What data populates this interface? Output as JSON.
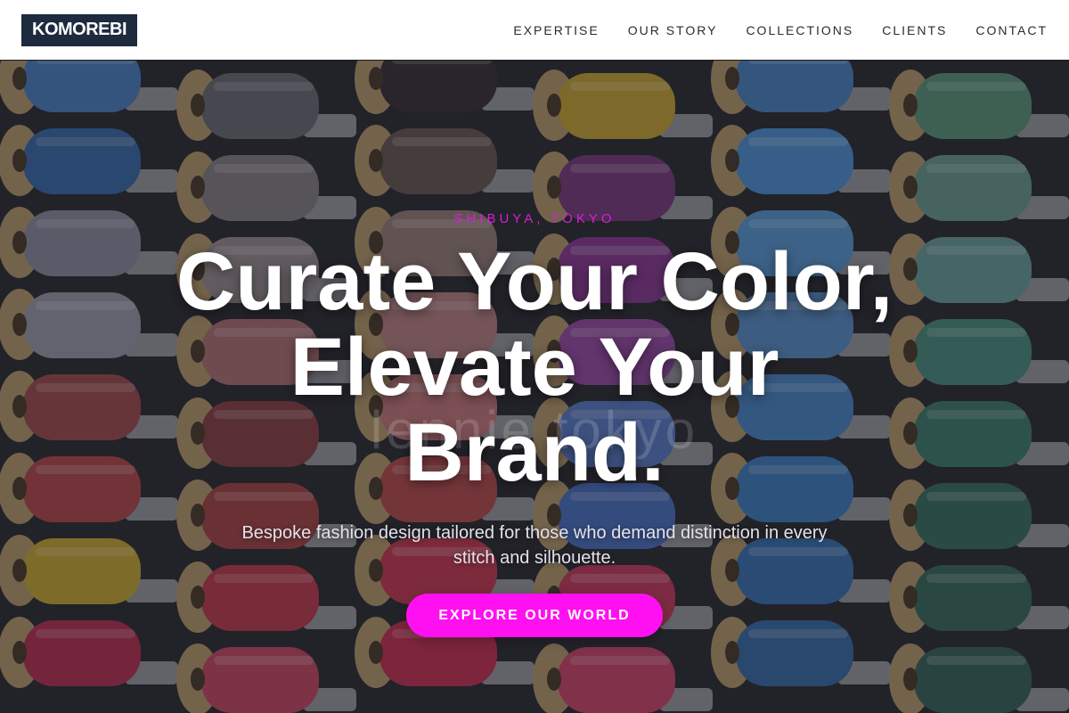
{
  "brand": {
    "logo_text": "KOMOREBI"
  },
  "nav": {
    "items": [
      {
        "label": "EXPERTISE"
      },
      {
        "label": "OUR STORY"
      },
      {
        "label": "COLLECTIONS"
      },
      {
        "label": "CLIENTS"
      },
      {
        "label": "CONTACT"
      }
    ]
  },
  "hero": {
    "eyebrow": "SHIBUYA, TOKYO",
    "headline_line1": "Curate Your Color,",
    "headline_line2": "Elevate Your",
    "headline_line3": "Brand.",
    "watermark": "lennie tokyo",
    "subtext": "Bespoke fashion design tailored for those who demand distinction in every stitch and silhouette.",
    "cta_label": "EXPLORE OUR WORLD",
    "background_image": "thread-spools-photo"
  },
  "colors": {
    "accent": "#ff10f0",
    "eyebrow": "#d61fd6",
    "logo_bg": "#1e2a3e",
    "header_bg": "#ffffff",
    "nav_text": "#2a2a34"
  },
  "spool_columns": [
    {
      "colors": [
        "#4a7fc0",
        "#3a6aa8",
        "#8a8e9c",
        "#9a9aa8",
        "#a04a4a",
        "#b44848",
        "#c8a830",
        "#b83050"
      ]
    },
    {
      "colors": [
        "#6a6a70",
        "#858082",
        "#9a8e8e",
        "#b07070",
        "#8a4040",
        "#a84444",
        "#c03a4a",
        "#c84860"
      ]
    },
    {
      "colors": [
        "#3a3034",
        "#6a5650",
        "#9a7e78",
        "#b88080",
        "#c47878",
        "#b84a4a",
        "#c83a50",
        "#c83050"
      ]
    },
    {
      "colors": [
        "#c8a430",
        "#7a3a7a",
        "#8c3a92",
        "#9a4aa4",
        "#5a7ac4",
        "#4a70c0",
        "#c83a5a",
        "#d04468"
      ]
    },
    {
      "colors": [
        "#4a84c0",
        "#4f92d4",
        "#5a98d0",
        "#5a8ec6",
        "#4a86c4",
        "#3e7cbc",
        "#3a72b0",
        "#3a6aa4"
      ]
    },
    {
      "colors": [
        "#5a9478",
        "#6a9a8c",
        "#6a9e9a",
        "#4a8c7a",
        "#3e7c6a",
        "#3a7060",
        "#3a6a58",
        "#386456"
      ]
    }
  ]
}
